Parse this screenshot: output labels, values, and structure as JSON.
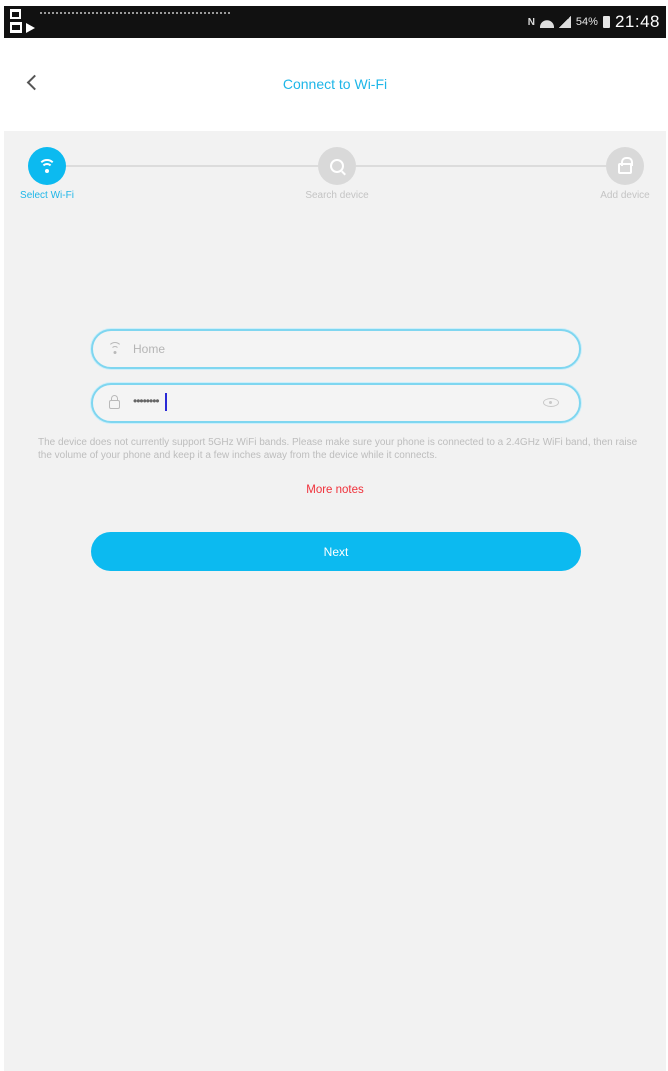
{
  "status_bar": {
    "indicators": "N",
    "battery_percent": "54%",
    "clock": "21:48",
    "icons": [
      "screenshot-icon",
      "image-icon",
      "play-store-icon",
      "nfc-icon",
      "wifi-icon",
      "signal-icon",
      "battery-icon"
    ]
  },
  "header": {
    "title": "Connect to Wi-Fi",
    "back_icon": "chevron-left-icon"
  },
  "stepper": {
    "steps": [
      {
        "label": "Select Wi-Fi",
        "icon": "wifi-icon",
        "state": "active"
      },
      {
        "label": "Search device",
        "icon": "search-icon",
        "state": "inactive"
      },
      {
        "label": "Add device",
        "icon": "lock-icon",
        "state": "inactive"
      }
    ]
  },
  "form": {
    "ssid_value": "Home",
    "password_mask": "••••••••",
    "notice": "The device does not currently support 5GHz WiFi bands. Please make sure your phone is connected to a 2.4GHz WiFi band, then raise the volume of your phone and keep it a few inches away from the device while it connects.",
    "more_notes": "More notes",
    "next_label": "Next"
  },
  "colors": {
    "accent": "#0cbaf0",
    "title": "#1eb6e8",
    "warning": "#f0303a",
    "background": "#f2f2f2"
  }
}
